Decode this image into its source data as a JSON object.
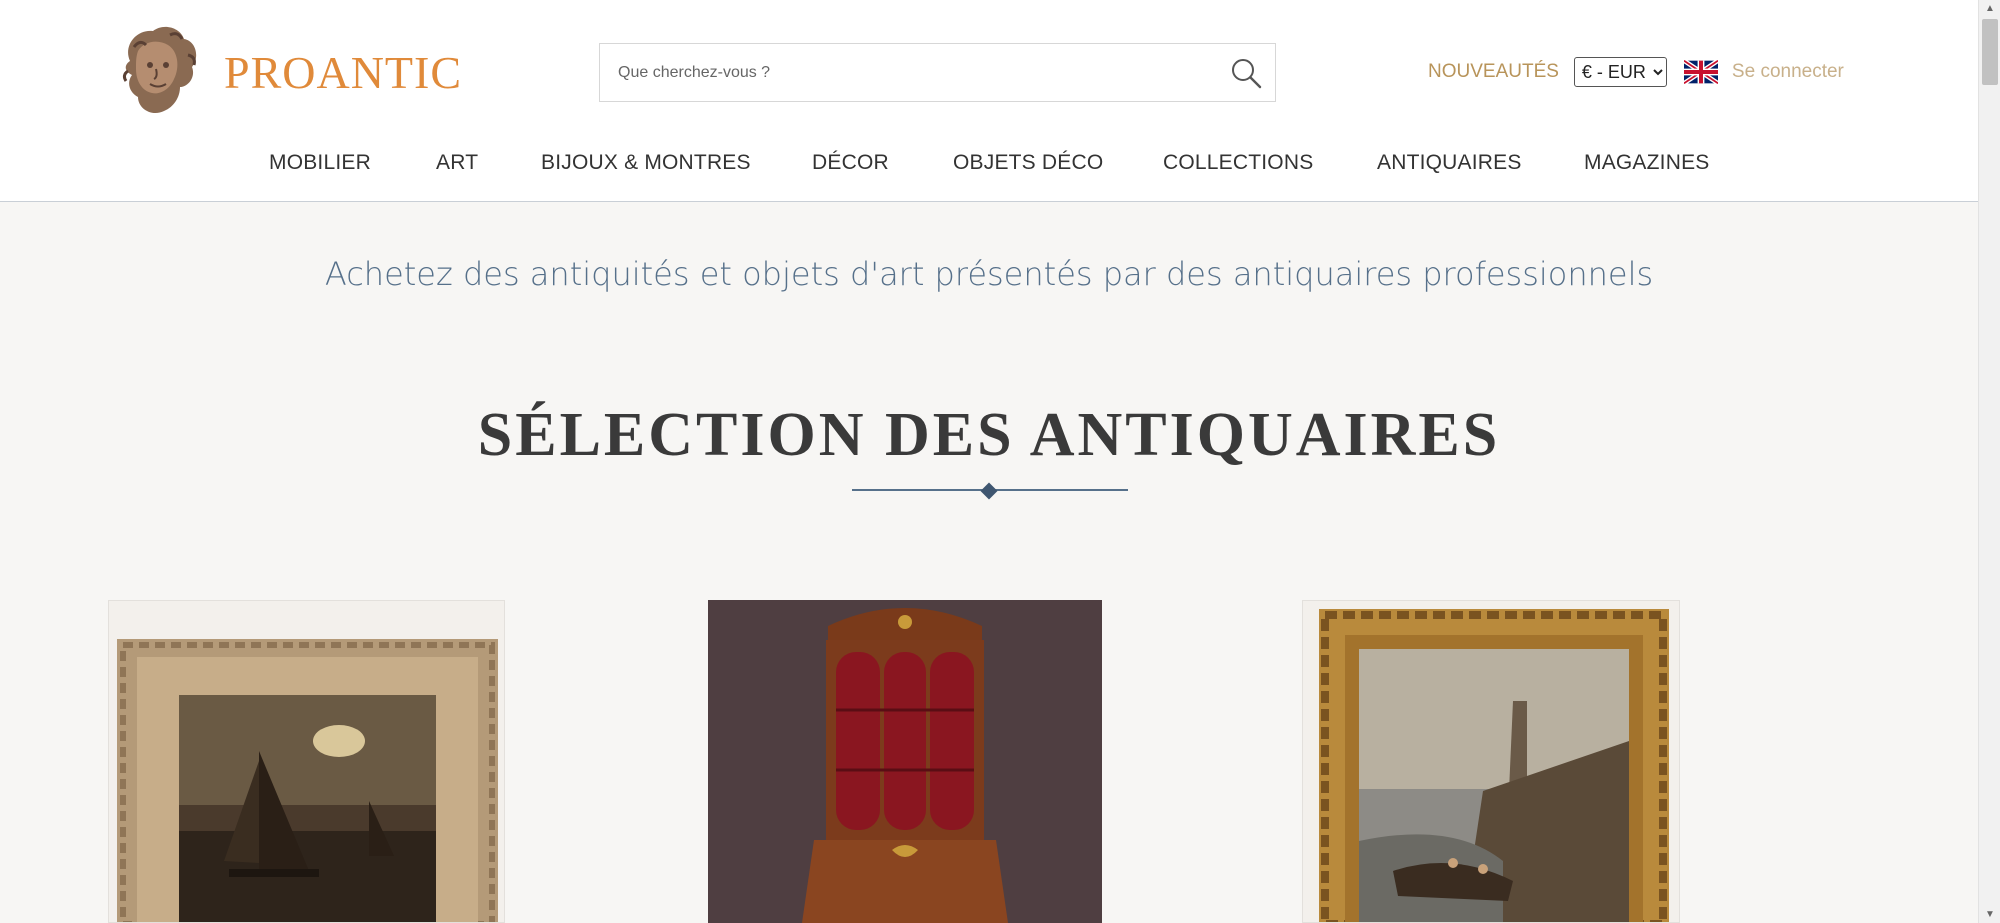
{
  "header": {
    "logo_text": "PROANTIC",
    "search": {
      "placeholder": "Que cherchez-vous ?",
      "value": ""
    },
    "new_link": "NOUVEAUTÉS",
    "currency": {
      "selected": "€ - EUR",
      "options": [
        "€ - EUR"
      ]
    },
    "flag_icon": "uk-flag-icon",
    "login_link": "Se connecter"
  },
  "nav": {
    "items": [
      {
        "label": "MOBILIER"
      },
      {
        "label": "ART"
      },
      {
        "label": "BIJOUX & MONTRES"
      },
      {
        "label": "DÉCOR"
      },
      {
        "label": "OBJETS DÉCO"
      },
      {
        "label": "COLLECTIONS"
      },
      {
        "label": "ANTIQUAIRES"
      },
      {
        "label": "MAGAZINES"
      }
    ]
  },
  "main": {
    "tagline": "Achetez des antiquités et objets d'art présentés par des antiquaires professionnels",
    "section_title": "SÉLECTION DES ANTIQUAIRES"
  },
  "colors": {
    "brand_orange": "#e08a3a",
    "gold": "#b8945a",
    "slate_blue": "#56708a"
  }
}
